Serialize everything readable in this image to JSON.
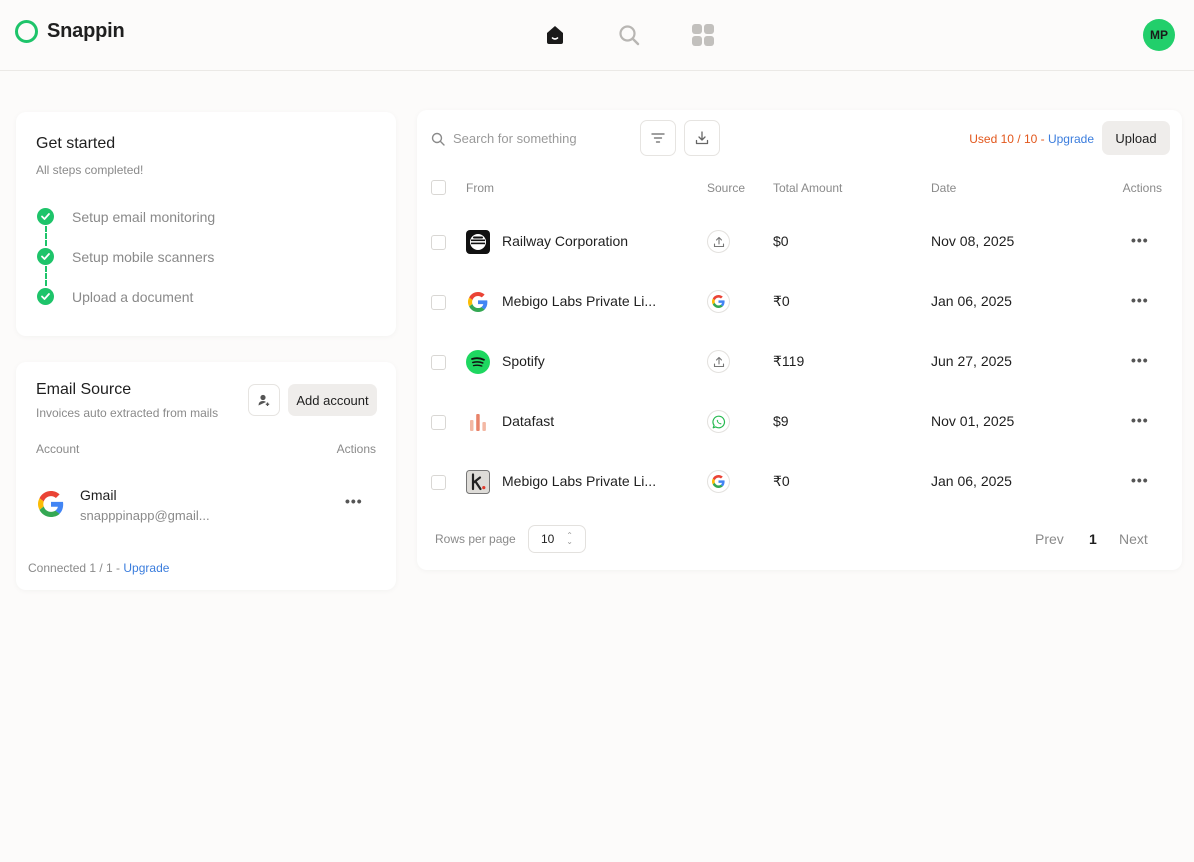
{
  "header": {
    "brand": "Snappin",
    "nav": [
      "home-icon",
      "search-icon",
      "apps-grid-icon"
    ],
    "avatar_initials": "MP"
  },
  "get_started": {
    "title": "Get started",
    "subtitle": "All steps completed!",
    "steps": [
      {
        "label": "Setup email monitoring",
        "done": true
      },
      {
        "label": "Setup mobile scanners",
        "done": true
      },
      {
        "label": "Upload a document",
        "done": true
      }
    ]
  },
  "email_source": {
    "title": "Email Source",
    "subtitle": "Invoices auto extracted from mails",
    "add_account_label": "Add account",
    "col_account": "Account",
    "col_actions": "Actions",
    "account": {
      "name": "Gmail",
      "email": "snapppinapp@gmail..."
    },
    "connected_text": "Connected 1 / 1 - ",
    "upgrade_label": "Upgrade"
  },
  "invoices": {
    "search_placeholder": "Search for something",
    "usage_text": "Used 10 / 10 - ",
    "upgrade_label": "Upgrade",
    "upload_label": "Upload",
    "columns": {
      "from": "From",
      "source": "Source",
      "amount": "Total Amount",
      "date": "Date",
      "actions": "Actions"
    },
    "rows": [
      {
        "from": "Railway Corporation",
        "logo": "railway-logo",
        "source": "upload-icon",
        "amount": "$0",
        "date": "Nov 08, 2025"
      },
      {
        "from": "Mebigo Labs Private Li...",
        "logo": "google-logo",
        "source": "google-icon",
        "amount": "₹0",
        "date": "Jan 06, 2025"
      },
      {
        "from": "Spotify",
        "logo": "spotify-logo",
        "source": "upload-icon",
        "amount": "₹119",
        "date": "Jun 27, 2025"
      },
      {
        "from": "Datafast",
        "logo": "datafast-logo",
        "source": "whatsapp-icon",
        "amount": "$9",
        "date": "Nov 01, 2025"
      },
      {
        "from": "Mebigo Labs Private Li...",
        "logo": "k-logo",
        "source": "google-icon",
        "amount": "₹0",
        "date": "Jan 06, 2025"
      }
    ],
    "rows_per_page_label": "Rows per page",
    "rows_per_page_value": "10",
    "prev_label": "Prev",
    "page": "1",
    "next_label": "Next"
  },
  "colors": {
    "accent": "#1ec46a",
    "link": "#3b7ddd",
    "warning": "#e2571c"
  }
}
